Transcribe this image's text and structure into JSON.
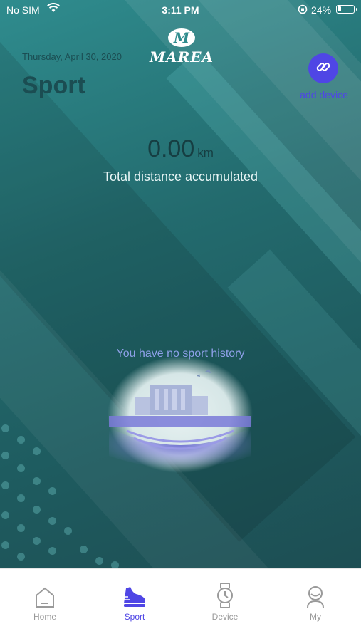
{
  "status_bar": {
    "carrier": "No SIM",
    "time": "3:11 PM",
    "battery": "24%"
  },
  "header": {
    "brand": "MAREA",
    "logo_letter": "M",
    "date": "Thursday, April 30, 2020",
    "title": "Sport",
    "add_device_label": "add device"
  },
  "summary": {
    "distance_value": "0.00",
    "distance_unit": "km",
    "distance_label": "Total distance accumulated"
  },
  "history": {
    "empty_message": "You have no sport history"
  },
  "tabs": [
    {
      "label": "Home",
      "icon": "home-icon",
      "active": false
    },
    {
      "label": "Sport",
      "icon": "shoe-icon",
      "active": true
    },
    {
      "label": "Device",
      "icon": "watch-icon",
      "active": false
    },
    {
      "label": "My",
      "icon": "user-icon",
      "active": false
    }
  ],
  "colors": {
    "accent": "#4f46e5",
    "background": "#236b6e",
    "inactive_tab": "#9a9a9a"
  }
}
